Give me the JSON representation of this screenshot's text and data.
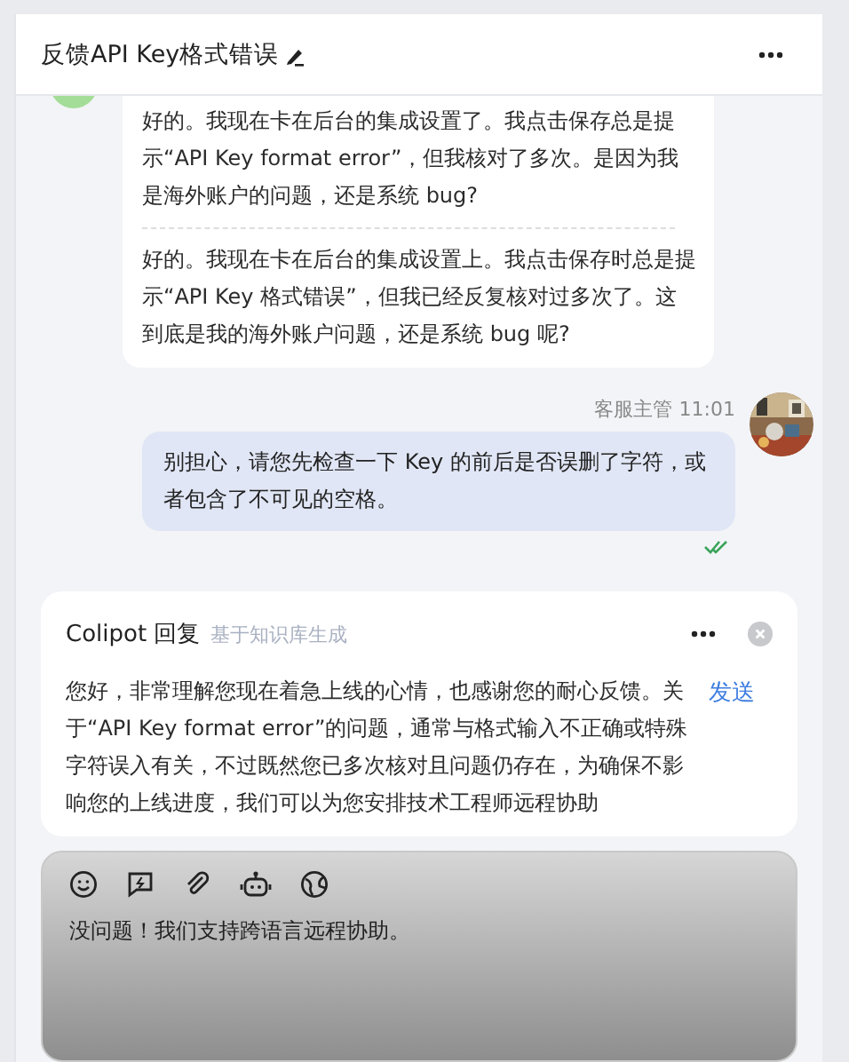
{
  "header": {
    "title": "反馈API Key格式错误"
  },
  "messages": [
    {
      "kind": "customer",
      "paragraphs": [
        "好的。我现在卡在后台的集成设置了。我点击保存总是提示“API Key format error”，但我核对了多次。是因为我是海外账户的问题，还是系统 bug?",
        "好的。我现在卡在后台的集成设置上。我点击保存时总是提示“API Key 格式错误”，但我已经反复核对过多次了。这到底是我的海外账户问题，还是系统 bug 呢?"
      ]
    },
    {
      "kind": "agent",
      "sender": "客服主管",
      "time": "11:01",
      "text": "别担心，请您先检查一下 Key 的前后是否误删了字符，或者包含了不可见的空格。",
      "read": true
    }
  ],
  "copilot": {
    "title": "Colipot 回复",
    "subtitle": "基于知识库生成",
    "text": "您好，非常理解您现在着急上线的心情，也感谢您的耐心反馈。关于“API Key format error”的问题，通常与格式输入不正确或特殊字符误入有关，不过既然您已多次核对且问题仍存在，为确保不影响您的上线进度，我们可以为您安排技术工程师远程协助",
    "send_label": "发送"
  },
  "composer": {
    "value": "没问题！我们支持跨语言远程协助。"
  }
}
